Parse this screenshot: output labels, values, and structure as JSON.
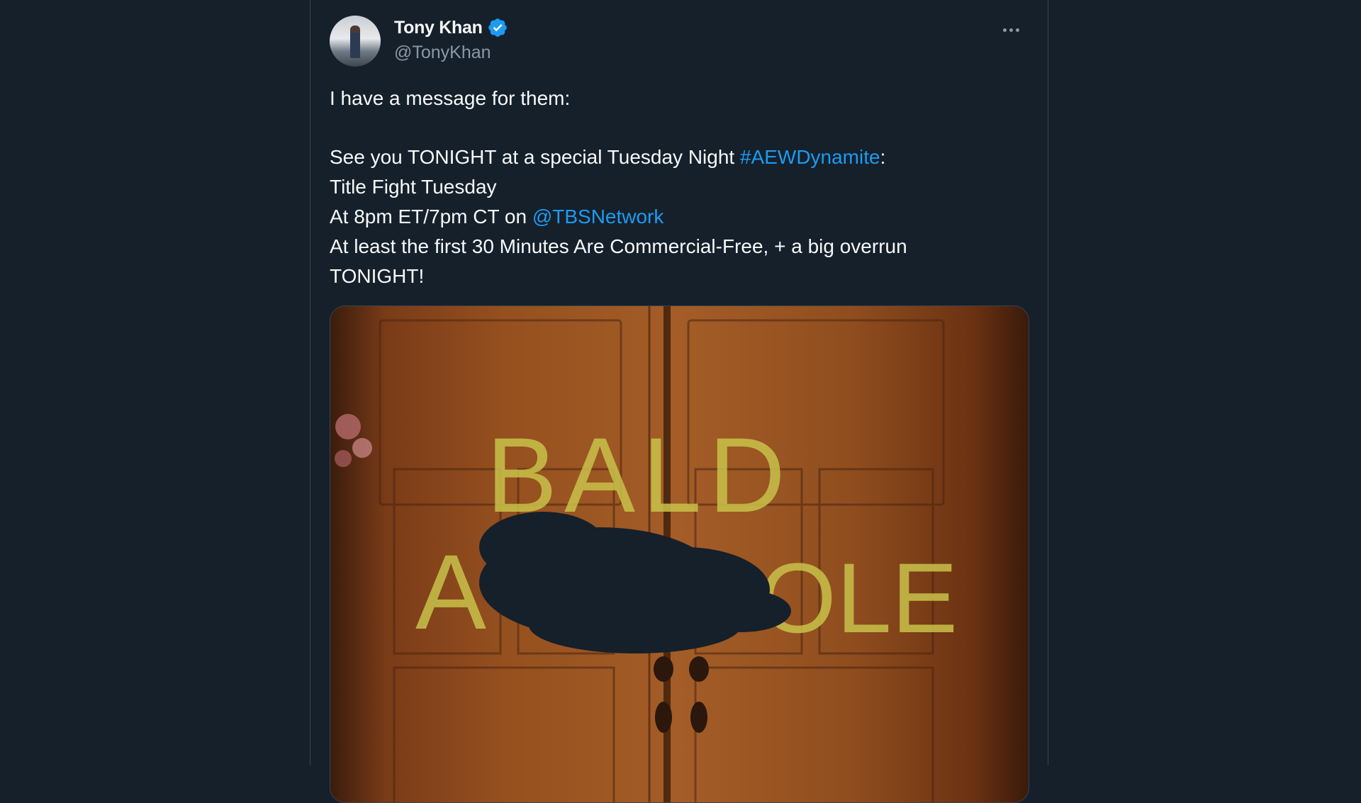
{
  "tweet": {
    "author_name": "Tony Khan",
    "author_handle": "@TonyKhan",
    "lines": [
      {
        "text": "I have a message for them:"
      },
      {
        "pre": "See you TONIGHT at a special Tuesday Night ",
        "link": "#AEWDynamite",
        "post": ":"
      },
      {
        "text": "Title Fight Tuesday"
      },
      {
        "pre": "At 8pm ET/7pm CT on ",
        "link": "@TBSNetwork",
        "post": ""
      },
      {
        "text": "At least the first 30 Minutes Are Commercial-Free, + a big overrun"
      },
      {
        "text": "TONIGHT!"
      }
    ]
  },
  "media": {
    "graffiti_line1": "BALD",
    "graffiti_line2_left": "A",
    "graffiti_line2_right": "OLE"
  },
  "icons": {
    "verified": "verified-badge-icon",
    "more": "more-options-icon"
  },
  "colors": {
    "background": "#15202b",
    "link": "#1d9bf0",
    "secondary_text": "#8b98a5",
    "graffiti": "#c9c24a"
  }
}
